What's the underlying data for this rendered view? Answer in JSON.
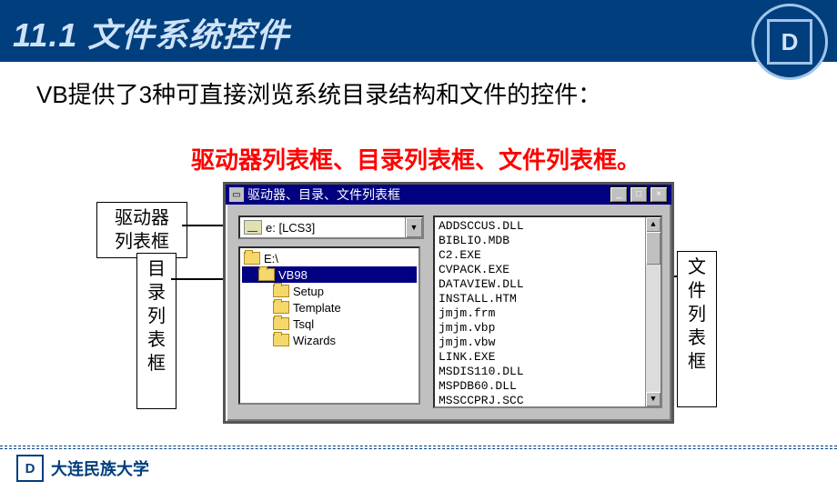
{
  "header": {
    "title": "11.1  文件系统控件",
    "logo_letter": "D"
  },
  "intro": "VB提供了3种可直接浏览系统目录结构和文件的控件：",
  "subtitle": "驱动器列表框、目录列表框、文件列表框。",
  "annotations": {
    "drive_label": "驱动器\n列表框",
    "dir_label": "目录列表框",
    "file_label": "文件列表框"
  },
  "vb_window": {
    "title": "驱动器、目录、文件列表框",
    "drive": {
      "text": "e: [LCS3]"
    },
    "dirs": [
      {
        "name": "E:\\",
        "indent": 0,
        "selected": false
      },
      {
        "name": "VB98",
        "indent": 1,
        "selected": true
      },
      {
        "name": "Setup",
        "indent": 2,
        "selected": false
      },
      {
        "name": "Template",
        "indent": 2,
        "selected": false
      },
      {
        "name": "Tsql",
        "indent": 2,
        "selected": false
      },
      {
        "name": "Wizards",
        "indent": 2,
        "selected": false
      }
    ],
    "files": [
      "ADDSCCUS.DLL",
      "BIBLIO.MDB",
      "C2.EXE",
      "CVPACK.EXE",
      "DATAVIEW.DLL",
      "INSTALL.HTM",
      "jmjm.frm",
      "jmjm.vbp",
      "jmjm.vbw",
      "LINK.EXE",
      "MSDIS110.DLL",
      "MSPDB60.DLL",
      "MSSCCPRJ.SCC"
    ]
  },
  "footer": {
    "university": "大连民族大学",
    "logo_letter": "D"
  }
}
